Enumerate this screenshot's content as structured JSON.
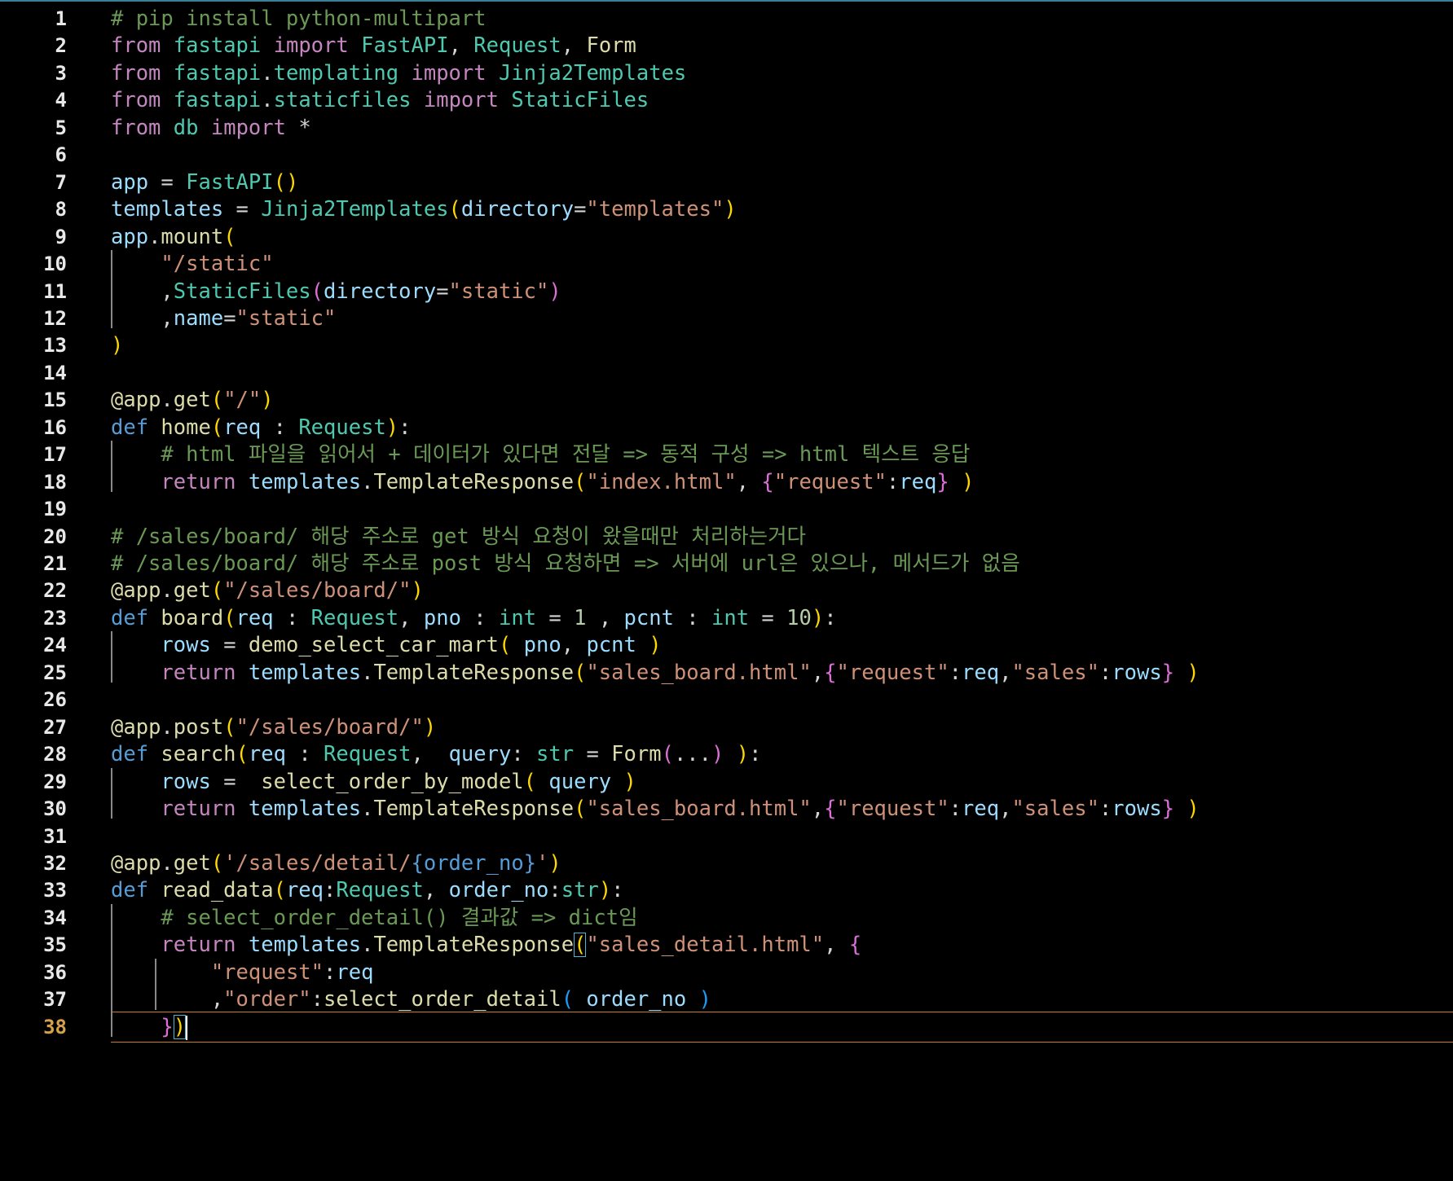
{
  "editor": {
    "current_line": 38,
    "colors": {
      "background": "#000000",
      "comment": "#6a9955",
      "keyword": "#c586c0",
      "storage": "#569cd6",
      "string": "#ce9178",
      "function": "#dcdcaa",
      "class": "#4ec9b0",
      "variable": "#9cdcfe",
      "number": "#b5cea8",
      "text": "#d4d4d4",
      "bracket1": "#ffd700",
      "bracket2": "#da70d6",
      "bracket3": "#179fff",
      "line_number": "#e8e8e8",
      "current_line_number": "#d7a14a"
    },
    "lines": [
      [
        [
          "# pip install python-multipart",
          "comment"
        ]
      ],
      [
        [
          "from",
          "keyword"
        ],
        [
          " ",
          ""
        ],
        [
          "fastapi",
          "class"
        ],
        [
          " ",
          ""
        ],
        [
          "import",
          "keyword"
        ],
        [
          " ",
          ""
        ],
        [
          "FastAPI",
          "class"
        ],
        [
          ", ",
          ""
        ],
        [
          "Request",
          "class"
        ],
        [
          ", ",
          ""
        ],
        [
          "Form",
          "function"
        ]
      ],
      [
        [
          "from",
          "keyword"
        ],
        [
          " ",
          ""
        ],
        [
          "fastapi",
          "class"
        ],
        [
          ".",
          ""
        ],
        [
          "templating",
          "class"
        ],
        [
          " ",
          ""
        ],
        [
          "import",
          "keyword"
        ],
        [
          " ",
          ""
        ],
        [
          "Jinja2Templates",
          "class"
        ]
      ],
      [
        [
          "from",
          "keyword"
        ],
        [
          " ",
          ""
        ],
        [
          "fastapi",
          "class"
        ],
        [
          ".",
          ""
        ],
        [
          "staticfiles",
          "class"
        ],
        [
          " ",
          ""
        ],
        [
          "import",
          "keyword"
        ],
        [
          " ",
          ""
        ],
        [
          "StaticFiles",
          "class"
        ]
      ],
      [
        [
          "from",
          "keyword"
        ],
        [
          " ",
          ""
        ],
        [
          "db",
          "class"
        ],
        [
          " ",
          ""
        ],
        [
          "import",
          "keyword"
        ],
        [
          " *",
          ""
        ]
      ],
      [],
      [
        [
          "app",
          "variable"
        ],
        [
          " = ",
          ""
        ],
        [
          "FastAPI",
          "class"
        ],
        [
          "()",
          "bracket1"
        ]
      ],
      [
        [
          "templates",
          "variable"
        ],
        [
          " = ",
          ""
        ],
        [
          "Jinja2Templates",
          "class"
        ],
        [
          "(",
          "bracket1"
        ],
        [
          "directory",
          "variable"
        ],
        [
          "=",
          ""
        ],
        [
          "\"templates\"",
          "string"
        ],
        [
          ")",
          "bracket1"
        ]
      ],
      [
        [
          "app",
          "variable"
        ],
        [
          ".",
          ""
        ],
        [
          "mount",
          "function"
        ],
        [
          "(",
          "bracket1"
        ]
      ],
      [
        [
          "    ",
          ""
        ],
        [
          "\"/static\"",
          "string"
        ]
      ],
      [
        [
          "    ,",
          ""
        ],
        [
          "StaticFiles",
          "class"
        ],
        [
          "(",
          "bracket2"
        ],
        [
          "directory",
          "variable"
        ],
        [
          "=",
          ""
        ],
        [
          "\"static\"",
          "string"
        ],
        [
          ")",
          "bracket2"
        ]
      ],
      [
        [
          "    ,",
          ""
        ],
        [
          "name",
          "variable"
        ],
        [
          "=",
          ""
        ],
        [
          "\"static\"",
          "string"
        ]
      ],
      [
        [
          ")",
          "bracket1"
        ]
      ],
      [],
      [
        [
          "@",
          "function"
        ],
        [
          "app",
          "function"
        ],
        [
          ".",
          ""
        ],
        [
          "get",
          "function"
        ],
        [
          "(",
          "bracket1"
        ],
        [
          "\"/\"",
          "string"
        ],
        [
          ")",
          "bracket1"
        ]
      ],
      [
        [
          "def",
          "storage"
        ],
        [
          " ",
          ""
        ],
        [
          "home",
          "function"
        ],
        [
          "(",
          "bracket1"
        ],
        [
          "req",
          "variable"
        ],
        [
          " : ",
          ""
        ],
        [
          "Request",
          "class"
        ],
        [
          ")",
          "bracket1"
        ],
        [
          ":",
          ""
        ]
      ],
      [
        [
          "    ",
          ""
        ],
        [
          "# html 파일을 읽어서 + 데이터가 있다면 전달 => 동적 구성 => html 텍스트 응답",
          "comment"
        ]
      ],
      [
        [
          "    ",
          ""
        ],
        [
          "return",
          "keyword"
        ],
        [
          " ",
          ""
        ],
        [
          "templates",
          "variable"
        ],
        [
          ".",
          ""
        ],
        [
          "TemplateResponse",
          "function"
        ],
        [
          "(",
          "bracket1"
        ],
        [
          "\"index.html\"",
          "string"
        ],
        [
          ", ",
          ""
        ],
        [
          "{",
          "bracket2"
        ],
        [
          "\"request\"",
          "string"
        ],
        [
          ":",
          ""
        ],
        [
          "req",
          "variable"
        ],
        [
          "}",
          "bracket2"
        ],
        [
          " ",
          ""
        ],
        [
          ")",
          "bracket1"
        ]
      ],
      [],
      [
        [
          "# /sales/board/ 해당 주소로 get 방식 요청이 왔을때만 처리하는거다",
          "comment"
        ]
      ],
      [
        [
          "# /sales/board/ 해당 주소로 post 방식 요청하면 => 서버에 url은 있으나, 메서드가 없음",
          "comment"
        ]
      ],
      [
        [
          "@",
          "function"
        ],
        [
          "app",
          "function"
        ],
        [
          ".",
          ""
        ],
        [
          "get",
          "function"
        ],
        [
          "(",
          "bracket1"
        ],
        [
          "\"/sales/board/\"",
          "string"
        ],
        [
          ")",
          "bracket1"
        ]
      ],
      [
        [
          "def",
          "storage"
        ],
        [
          " ",
          ""
        ],
        [
          "board",
          "function"
        ],
        [
          "(",
          "bracket1"
        ],
        [
          "req",
          "variable"
        ],
        [
          " : ",
          ""
        ],
        [
          "Request",
          "class"
        ],
        [
          ", ",
          ""
        ],
        [
          "pno",
          "variable"
        ],
        [
          " : ",
          ""
        ],
        [
          "int",
          "class"
        ],
        [
          " = ",
          ""
        ],
        [
          "1",
          "number"
        ],
        [
          " , ",
          ""
        ],
        [
          "pcnt",
          "variable"
        ],
        [
          " : ",
          ""
        ],
        [
          "int",
          "class"
        ],
        [
          " = ",
          ""
        ],
        [
          "10",
          "number"
        ],
        [
          ")",
          "bracket1"
        ],
        [
          ":",
          ""
        ]
      ],
      [
        [
          "    ",
          ""
        ],
        [
          "rows",
          "variable"
        ],
        [
          " = ",
          ""
        ],
        [
          "demo_select_car_mart",
          "function"
        ],
        [
          "(",
          "bracket1"
        ],
        [
          " ",
          ""
        ],
        [
          "pno",
          "variable"
        ],
        [
          ", ",
          ""
        ],
        [
          "pcnt",
          "variable"
        ],
        [
          " ",
          ""
        ],
        [
          ")",
          "bracket1"
        ]
      ],
      [
        [
          "    ",
          ""
        ],
        [
          "return",
          "keyword"
        ],
        [
          " ",
          ""
        ],
        [
          "templates",
          "variable"
        ],
        [
          ".",
          ""
        ],
        [
          "TemplateResponse",
          "function"
        ],
        [
          "(",
          "bracket1"
        ],
        [
          "\"sales_board.html\"",
          "string"
        ],
        [
          ",",
          ""
        ],
        [
          "{",
          "bracket2"
        ],
        [
          "\"request\"",
          "string"
        ],
        [
          ":",
          ""
        ],
        [
          "req",
          "variable"
        ],
        [
          ",",
          ""
        ],
        [
          "\"sales\"",
          "string"
        ],
        [
          ":",
          ""
        ],
        [
          "rows",
          "variable"
        ],
        [
          "}",
          "bracket2"
        ],
        [
          " ",
          ""
        ],
        [
          ")",
          "bracket1"
        ]
      ],
      [],
      [
        [
          "@",
          "function"
        ],
        [
          "app",
          "function"
        ],
        [
          ".",
          ""
        ],
        [
          "post",
          "function"
        ],
        [
          "(",
          "bracket1"
        ],
        [
          "\"/sales/board/\"",
          "string"
        ],
        [
          ")",
          "bracket1"
        ]
      ],
      [
        [
          "def",
          "storage"
        ],
        [
          " ",
          ""
        ],
        [
          "search",
          "function"
        ],
        [
          "(",
          "bracket1"
        ],
        [
          "req",
          "variable"
        ],
        [
          " : ",
          ""
        ],
        [
          "Request",
          "class"
        ],
        [
          ",  ",
          ""
        ],
        [
          "query",
          "variable"
        ],
        [
          ": ",
          ""
        ],
        [
          "str",
          "class"
        ],
        [
          " = ",
          ""
        ],
        [
          "Form",
          "function"
        ],
        [
          "(",
          "bracket2"
        ],
        [
          "...",
          ""
        ],
        [
          ")",
          "bracket2"
        ],
        [
          " ",
          ""
        ],
        [
          ")",
          "bracket1"
        ],
        [
          ":",
          ""
        ]
      ],
      [
        [
          "    ",
          ""
        ],
        [
          "rows",
          "variable"
        ],
        [
          " =  ",
          ""
        ],
        [
          "select_order_by_model",
          "function"
        ],
        [
          "(",
          "bracket1"
        ],
        [
          " ",
          ""
        ],
        [
          "query",
          "variable"
        ],
        [
          " ",
          ""
        ],
        [
          ")",
          "bracket1"
        ]
      ],
      [
        [
          "    ",
          ""
        ],
        [
          "return",
          "keyword"
        ],
        [
          " ",
          ""
        ],
        [
          "templates",
          "variable"
        ],
        [
          ".",
          ""
        ],
        [
          "TemplateResponse",
          "function"
        ],
        [
          "(",
          "bracket1"
        ],
        [
          "\"sales_board.html\"",
          "string"
        ],
        [
          ",",
          ""
        ],
        [
          "{",
          "bracket2"
        ],
        [
          "\"request\"",
          "string"
        ],
        [
          ":",
          ""
        ],
        [
          "req",
          "variable"
        ],
        [
          ",",
          ""
        ],
        [
          "\"sales\"",
          "string"
        ],
        [
          ":",
          ""
        ],
        [
          "rows",
          "variable"
        ],
        [
          "}",
          "bracket2"
        ],
        [
          " ",
          ""
        ],
        [
          ")",
          "bracket1"
        ]
      ],
      [],
      [
        [
          "@",
          "function"
        ],
        [
          "app",
          "function"
        ],
        [
          ".",
          ""
        ],
        [
          "get",
          "function"
        ],
        [
          "(",
          "bracket1"
        ],
        [
          "'/sales/detail/",
          "string"
        ],
        [
          "{order_no}",
          "storage"
        ],
        [
          "'",
          "string"
        ],
        [
          ")",
          "bracket1"
        ]
      ],
      [
        [
          "def",
          "storage"
        ],
        [
          " ",
          ""
        ],
        [
          "read_data",
          "function"
        ],
        [
          "(",
          "bracket1"
        ],
        [
          "req",
          "variable"
        ],
        [
          ":",
          ""
        ],
        [
          "Request",
          "class"
        ],
        [
          ", ",
          ""
        ],
        [
          "order_no",
          "variable"
        ],
        [
          ":",
          ""
        ],
        [
          "str",
          "class"
        ],
        [
          ")",
          "bracket1"
        ],
        [
          ":",
          ""
        ]
      ],
      [
        [
          "    ",
          ""
        ],
        [
          "# select_order_detail() 결과값 => dict임",
          "comment"
        ]
      ],
      [
        [
          "    ",
          ""
        ],
        [
          "return",
          "keyword"
        ],
        [
          " ",
          ""
        ],
        [
          "templates",
          "variable"
        ],
        [
          ".",
          ""
        ],
        [
          "TemplateResponse",
          "function"
        ],
        [
          "(",
          "bracket1 bm"
        ],
        [
          "\"sales_detail.html\"",
          "string"
        ],
        [
          ", ",
          ""
        ],
        [
          "{",
          "bracket2"
        ]
      ],
      [
        [
          "        ",
          ""
        ],
        [
          "\"request\"",
          "string"
        ],
        [
          ":",
          ""
        ],
        [
          "req",
          "variable"
        ]
      ],
      [
        [
          "        ,",
          ""
        ],
        [
          "\"order\"",
          "string"
        ],
        [
          ":",
          ""
        ],
        [
          "select_order_detail",
          "function"
        ],
        [
          "(",
          "bracket3"
        ],
        [
          " ",
          ""
        ],
        [
          "order_no",
          "variable"
        ],
        [
          " ",
          ""
        ],
        [
          ")",
          "bracket3"
        ]
      ],
      [
        [
          "    ",
          ""
        ],
        [
          "}",
          "bracket2"
        ],
        [
          ")",
          "bracket1 bm"
        ]
      ]
    ]
  }
}
